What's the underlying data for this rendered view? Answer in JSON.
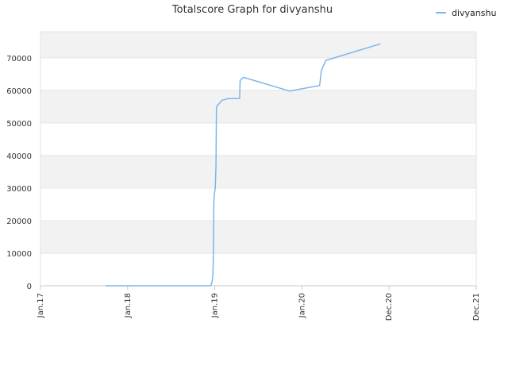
{
  "chart_data": {
    "type": "line",
    "title": "Totalscore Graph for divyanshu",
    "xlabel": "",
    "ylabel": "",
    "legend_position": "top-right",
    "grid": true,
    "x_ticks": [
      "Jan.17",
      "Jan.18",
      "Jan.19",
      "Jan.20",
      "Dec.20",
      "Dec.21"
    ],
    "y_ticks": [
      "0",
      "10000",
      "20000",
      "30000",
      "40000",
      "50000",
      "60000",
      "70000"
    ],
    "ylim": [
      0,
      78000
    ],
    "xlim": [
      "2017-01-01",
      "2021-12-31"
    ],
    "series": [
      {
        "name": "divyanshu",
        "color": "#7cb5ec",
        "points": [
          {
            "x": "2017-10-01",
            "y": 0
          },
          {
            "x": "2018-12-15",
            "y": 0
          },
          {
            "x": "2018-12-20",
            "y": 1000
          },
          {
            "x": "2018-12-24",
            "y": 3000
          },
          {
            "x": "2018-12-26",
            "y": 10000
          },
          {
            "x": "2018-12-28",
            "y": 25000
          },
          {
            "x": "2018-12-30",
            "y": 28000
          },
          {
            "x": "2019-01-03",
            "y": 30000
          },
          {
            "x": "2019-01-06",
            "y": 37000
          },
          {
            "x": "2019-01-08",
            "y": 55000
          },
          {
            "x": "2019-01-20",
            "y": 56000
          },
          {
            "x": "2019-02-01",
            "y": 57000
          },
          {
            "x": "2019-03-01",
            "y": 57500
          },
          {
            "x": "2019-04-15",
            "y": 57500
          },
          {
            "x": "2019-04-17",
            "y": 63000
          },
          {
            "x": "2019-05-01",
            "y": 64000
          },
          {
            "x": "2019-11-10",
            "y": 59800
          },
          {
            "x": "2020-03-15",
            "y": 61500
          },
          {
            "x": "2020-03-22",
            "y": 66000
          },
          {
            "x": "2020-04-10",
            "y": 69200
          },
          {
            "x": "2020-11-25",
            "y": 74300
          }
        ]
      }
    ]
  }
}
